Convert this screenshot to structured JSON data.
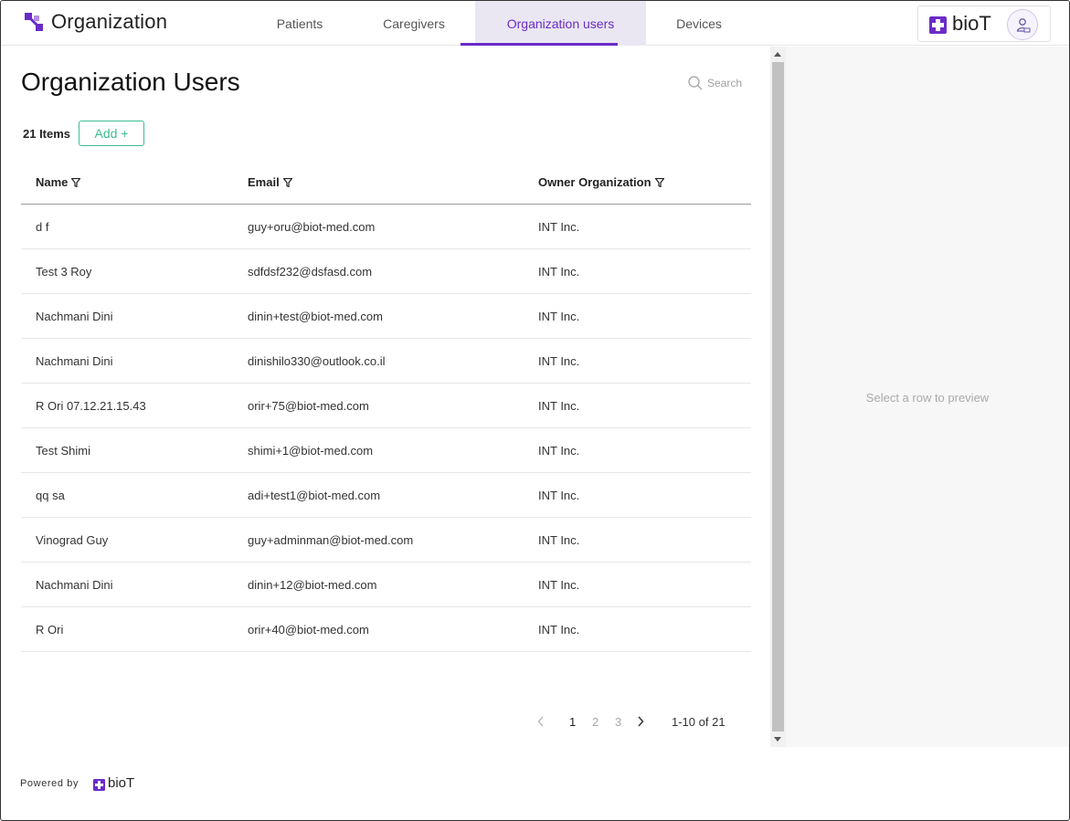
{
  "header": {
    "title": "Organization",
    "tabs": [
      {
        "label": "Patients",
        "active": false
      },
      {
        "label": "Caregivers",
        "active": false
      },
      {
        "label": "Organization users",
        "active": true
      },
      {
        "label": "Devices",
        "active": false
      }
    ],
    "brand": "bioT",
    "accent_color": "#6b2bc8"
  },
  "main": {
    "page_title": "Organization Users",
    "search_placeholder": "Search",
    "items_count": "21 Items",
    "add_label": "Add +",
    "columns": [
      "Name",
      "Email",
      "Owner Organization"
    ],
    "rows": [
      {
        "name": "d f",
        "email": "guy+oru@biot-med.com",
        "org": "INT Inc."
      },
      {
        "name": "Test 3 Roy",
        "email": "sdfdsf232@dsfasd.com",
        "org": "INT Inc."
      },
      {
        "name": "Nachmani Dini",
        "email": "dinin+test@biot-med.com",
        "org": "INT Inc."
      },
      {
        "name": "Nachmani Dini",
        "email": "dinishilo330@outlook.co.il",
        "org": "INT Inc."
      },
      {
        "name": "R Ori 07.12.21.15.43",
        "email": "orir+75@biot-med.com",
        "org": "INT Inc."
      },
      {
        "name": "Test Shimi",
        "email": "shimi+1@biot-med.com",
        "org": "INT Inc."
      },
      {
        "name": "qq sa",
        "email": "adi+test1@biot-med.com",
        "org": "INT Inc."
      },
      {
        "name": "Vinograd Guy",
        "email": "guy+adminman@biot-med.com",
        "org": "INT Inc."
      },
      {
        "name": "Nachmani Dini",
        "email": "dinin+12@biot-med.com",
        "org": "INT Inc."
      },
      {
        "name": "R Ori",
        "email": "orir+40@biot-med.com",
        "org": "INT Inc."
      }
    ],
    "pagination": {
      "pages": [
        "1",
        "2",
        "3"
      ],
      "current": "1",
      "range": "1-10 of 21"
    }
  },
  "preview": {
    "empty_text": "Select a row to preview"
  },
  "footer": {
    "powered_by": "Powered by",
    "brand": "bioT"
  },
  "colors": {
    "add_button": "#3dbd8e",
    "active_tab_bg": "#eae7f3"
  }
}
